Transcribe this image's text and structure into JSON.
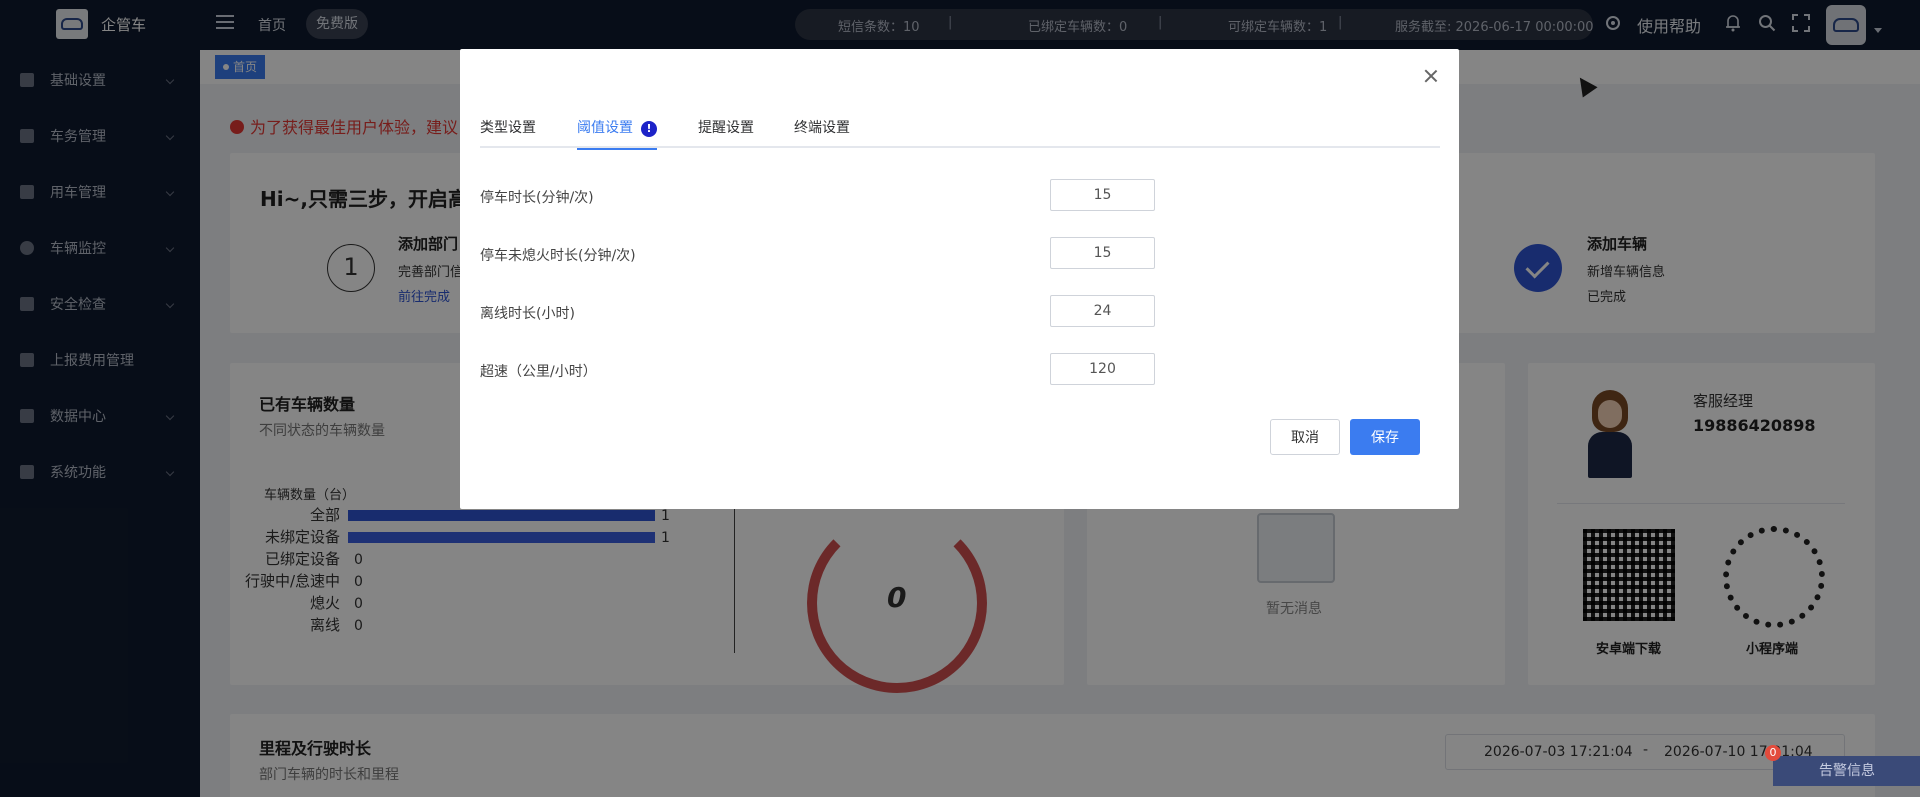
{
  "topbar": {
    "brand": "企管车",
    "nav_home": "首页",
    "plan_badge": "免费版",
    "stats": {
      "sms": "短信条数：10",
      "bound": "已绑定车辆数：0",
      "bindable": "可绑定车辆数：1",
      "service": "服务截至: 2026-06-17 00:00:00"
    },
    "separator": "|",
    "help": "使用帮助"
  },
  "sidebar": {
    "items": [
      {
        "label": "基础设置",
        "icon": "user-icon"
      },
      {
        "label": "车务管理",
        "icon": "monitor-icon"
      },
      {
        "label": "用车管理",
        "icon": "document-icon"
      },
      {
        "label": "车辆监控",
        "icon": "globe-icon"
      },
      {
        "label": "安全检查",
        "icon": "calendar-icon"
      },
      {
        "label": "上报费用管理",
        "icon": "grid-icon"
      },
      {
        "label": "数据中心",
        "icon": "lock-icon"
      },
      {
        "label": "系统功能",
        "icon": "move-icon"
      }
    ]
  },
  "content": {
    "tag_home": "首页",
    "warning": "为了获得最佳用户体验，建议",
    "steps_title": "Hi~,只需三步，开启高",
    "step1": {
      "num": "1",
      "title": "添加部门",
      "desc": "完善部门信",
      "link": "前往完成"
    },
    "step3": {
      "title": "添加车辆",
      "desc": "新增车辆信息",
      "status": "已完成"
    },
    "vehicle_card": {
      "title": "已有车辆数量",
      "subtitle": "不同状态的车辆数量",
      "chart_label": "车辆数量（台）"
    },
    "gauge_value": "0",
    "empty_msg": "暂无消息",
    "manager": {
      "title": "客服经理",
      "phone": "19886420898"
    },
    "qr": {
      "android": "安卓端下载",
      "mini": "小程序端"
    },
    "mileage": {
      "title": "里程及行驶时长",
      "subtitle": "部门车辆的时长和里程",
      "date_start": "2026-07-03 17:21:04",
      "date_sep": "-",
      "date_end": "2026-07-10 17:21:04"
    },
    "alert_float": "告警信息",
    "alert_count": "0"
  },
  "chart_data": {
    "type": "bar",
    "title": "车辆数量（台）",
    "categories": [
      "全部",
      "未绑定设备",
      "已绑定设备",
      "行驶中/怠速中",
      "熄火",
      "离线"
    ],
    "values": [
      1,
      1,
      0,
      0,
      0,
      0
    ],
    "colors": [
      "#2f55d4",
      "#3b5fe0",
      "#2f55d4",
      "#2f55d4",
      "#2f55d4",
      "#2f55d4"
    ]
  },
  "modal": {
    "tabs": [
      {
        "label": "类型设置",
        "active": false
      },
      {
        "label": "阈值设置",
        "active": true,
        "badge": "!"
      },
      {
        "label": "提醒设置",
        "active": false
      },
      {
        "label": "终端设置",
        "active": false
      }
    ],
    "fields": [
      {
        "label": "停车时长(分钟/次)",
        "value": "15"
      },
      {
        "label": "停车未熄火时长(分钟/次)",
        "value": "15"
      },
      {
        "label": "离线时长(小时)",
        "value": "24"
      },
      {
        "label": "超速（公里/小时）",
        "value": "120"
      }
    ],
    "cancel_label": "取消",
    "save_label": "保存"
  },
  "colors": {
    "accent": "#3b7cf0",
    "sidebar_bg": "#0f1a2e",
    "warning": "#e53935",
    "badge": "#1d23c8"
  }
}
